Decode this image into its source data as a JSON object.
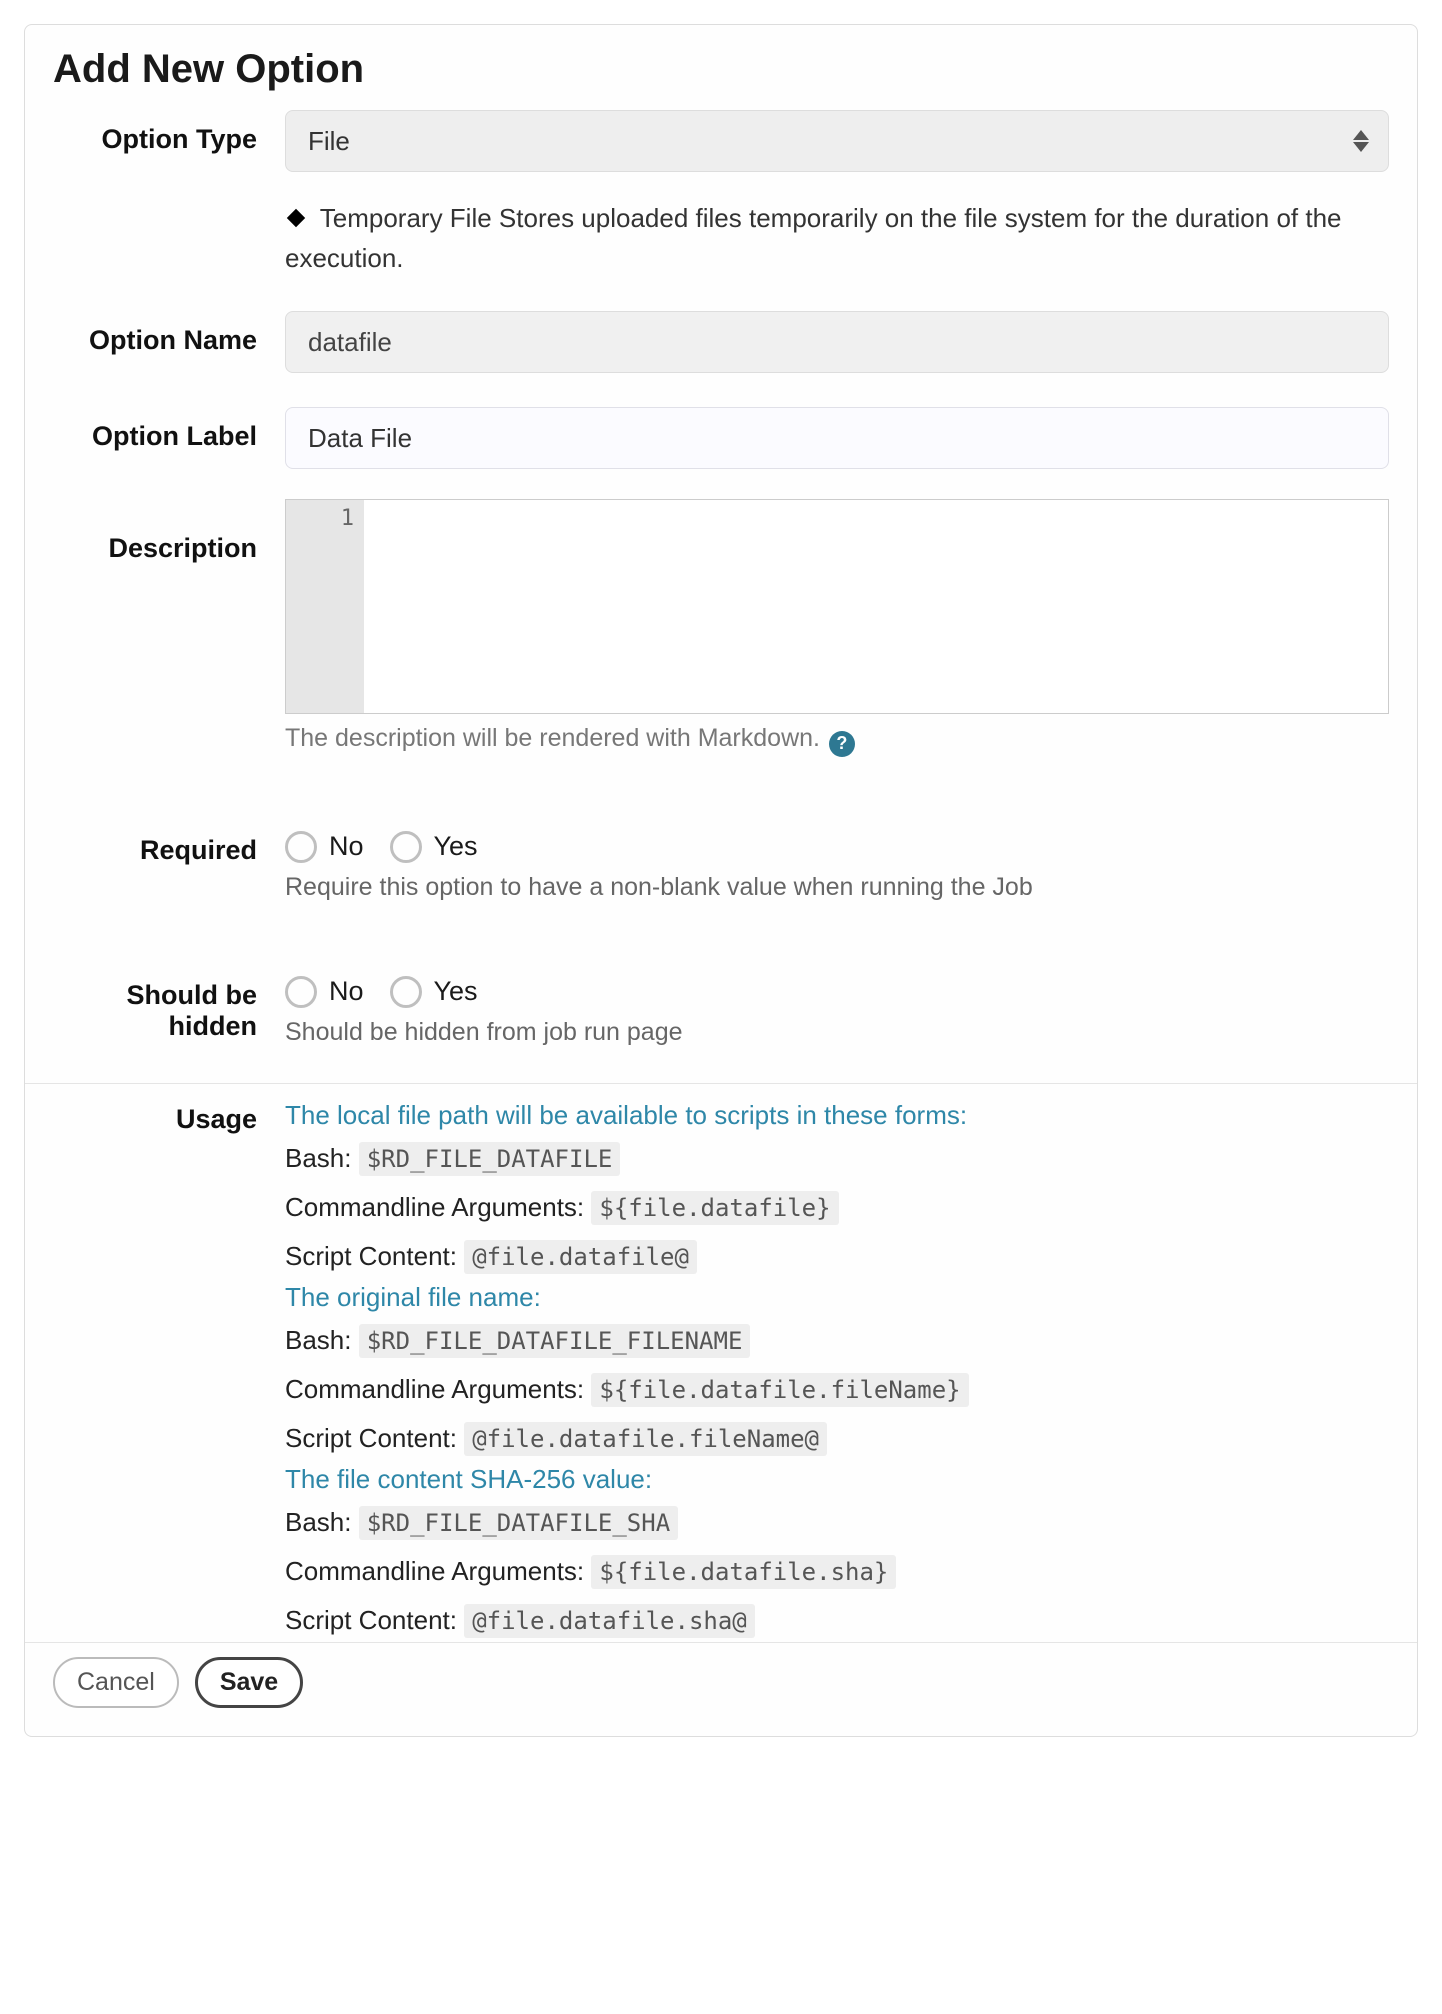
{
  "title": "Add New Option",
  "fields": {
    "optionType": {
      "label": "Option Type",
      "value": "File",
      "desc_bold": "Temporary File",
      "desc_rest": " Stores uploaded files temporarily on the file system for the duration of the execution."
    },
    "optionName": {
      "label": "Option Name",
      "value": "datafile"
    },
    "optionLabel": {
      "label": "Option Label",
      "value": "Data File"
    },
    "description": {
      "label": "Description",
      "gutter": "1",
      "help": "The description will be rendered with Markdown. "
    },
    "required": {
      "label": "Required",
      "no": "No",
      "yes": "Yes",
      "help": "Require this option to have a non-blank value when running the Job"
    },
    "hidden": {
      "label1": "Should be",
      "label2": "hidden",
      "no": "No",
      "yes": "Yes",
      "help": "Should be hidden from job run page"
    },
    "usage": {
      "label": "Usage",
      "h1": "The local file path will be available to scripts in these forms:",
      "bash1_label": "Bash: ",
      "bash1_code": "$RD_FILE_DATAFILE",
      "cli1_label": "Commandline Arguments: ",
      "cli1_code": "${file.datafile}",
      "sc1_label": "Script Content: ",
      "sc1_code": "@file.datafile@",
      "h2": "The original file name:",
      "bash2_label": "Bash: ",
      "bash2_code": "$RD_FILE_DATAFILE_FILENAME",
      "cli2_label": "Commandline Arguments: ",
      "cli2_code": "${file.datafile.fileName}",
      "sc2_label": "Script Content: ",
      "sc2_code": "@file.datafile.fileName@",
      "h3": "The file content SHA-256 value:",
      "bash3_label": "Bash: ",
      "bash3_code": "$RD_FILE_DATAFILE_SHA",
      "cli3_label": "Commandline Arguments: ",
      "cli3_code": "${file.datafile.sha}",
      "sc3_label": "Script Content: ",
      "sc3_code": "@file.datafile.sha@"
    }
  },
  "buttons": {
    "cancel": "Cancel",
    "save": "Save"
  }
}
